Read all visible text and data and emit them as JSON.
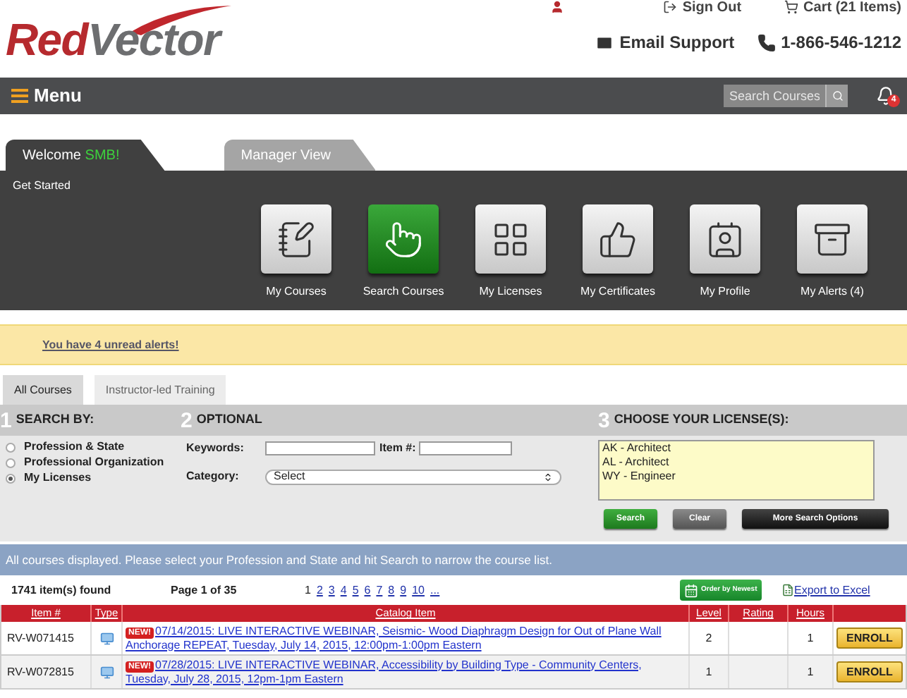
{
  "header": {
    "logo": {
      "first": "Red",
      "second": "Vector"
    },
    "top_links": [
      {
        "kind": "signout",
        "label": "Sign Out"
      },
      {
        "kind": "cart",
        "label": "Cart (21 Items)"
      }
    ],
    "contact": [
      {
        "kind": "email",
        "label": "Email Support"
      },
      {
        "kind": "phone",
        "label": "1-866-546-1212"
      }
    ]
  },
  "menu_bar": {
    "label": "Menu",
    "search": {
      "placeholder": "Search Courses"
    },
    "alerts_badge": "4"
  },
  "view_tabs": [
    {
      "label": "Welcome",
      "highlight": "SMB!",
      "selected": true
    },
    {
      "label": "Manager View",
      "selected": false
    }
  ],
  "dashboard": {
    "title": "Get Started",
    "tiles": [
      {
        "kind": "courses",
        "label": "My Courses",
        "selected": false
      },
      {
        "kind": "search",
        "label": "Search Courses",
        "selected": true
      },
      {
        "kind": "licenses",
        "label": "My Licenses",
        "selected": false
      },
      {
        "kind": "certificates",
        "label": "My Certificates",
        "selected": false
      },
      {
        "kind": "profile",
        "label": "My Profile",
        "selected": false
      },
      {
        "kind": "alerts",
        "label": "My Alerts (4)",
        "selected": false
      }
    ]
  },
  "alert_banner": {
    "link": "You have 4 unread alerts!"
  },
  "course_tabs": [
    {
      "label": "All Courses",
      "selected": true
    },
    {
      "label": "Instructor-led Training",
      "selected": false
    }
  ],
  "search": {
    "sections": [
      {
        "number": "1",
        "title": "SEARCH BY:"
      },
      {
        "number": "2",
        "title": "OPTIONAL"
      },
      {
        "number": "3",
        "title": "CHOOSE YOUR LICENSE(S):"
      }
    ],
    "search_by": [
      {
        "label": "Profession & State",
        "selected": false
      },
      {
        "label": "Professional Organization",
        "selected": false
      },
      {
        "label": "My Licenses",
        "selected": true
      }
    ],
    "keywords": {
      "label": "Keywords:"
    },
    "item_number": {
      "label": "Item #:"
    },
    "category": {
      "label": "Category:",
      "value": "Select"
    },
    "licenses": [
      "AK - Architect",
      "AL - Architect",
      "WY - Engineer"
    ],
    "buttons": [
      {
        "kind": "search",
        "label": "Search"
      },
      {
        "kind": "clear",
        "label": "Clear"
      },
      {
        "kind": "more",
        "label": "More Search Options"
      }
    ]
  },
  "info_bar": "All courses displayed. Please select your Profession and State and hit Search to narrow the course list.",
  "results": {
    "count": "1741 item(s) found",
    "page": "Page 1 of 35",
    "pages": [
      {
        "label": "1",
        "selected": true
      },
      {
        "label": "2",
        "selected": false
      },
      {
        "label": "3",
        "selected": false
      },
      {
        "label": "4",
        "selected": false
      },
      {
        "label": "5",
        "selected": false
      },
      {
        "label": "6",
        "selected": false
      },
      {
        "label": "7",
        "selected": false
      },
      {
        "label": "8",
        "selected": false
      },
      {
        "label": "9",
        "selected": false
      },
      {
        "label": "10",
        "selected": false
      },
      {
        "label": "...",
        "selected": false
      }
    ],
    "order_button": "Order by Newest",
    "export_link": "Export to Excel"
  },
  "table": {
    "columns": [
      "Item #",
      "Type",
      "Catalog Item",
      "Level",
      "Rating",
      "Hours"
    ],
    "rows": [
      {
        "item": "RV-W071415",
        "badge": "NEW!",
        "title": "07/14/2015: LIVE INTERACTIVE WEBINAR, Seismic- Wood Diaphragm Design for Out of Plane Wall Anchorage REPEAT, Tuesday, July 14, 2015, 12:00pm-1:00pm Eastern",
        "level": "2",
        "hours": "1",
        "action": "ENROLL"
      },
      {
        "item": "RV-W072815",
        "badge": "NEW!",
        "title": "07/28/2015: LIVE INTERACTIVE WEBINAR, Accessibility by Building Type - Community Centers, Tuesday, July 28, 2015, 12pm-1pm Eastern",
        "level": "1",
        "hours": "1",
        "action": "ENROLL"
      }
    ]
  }
}
